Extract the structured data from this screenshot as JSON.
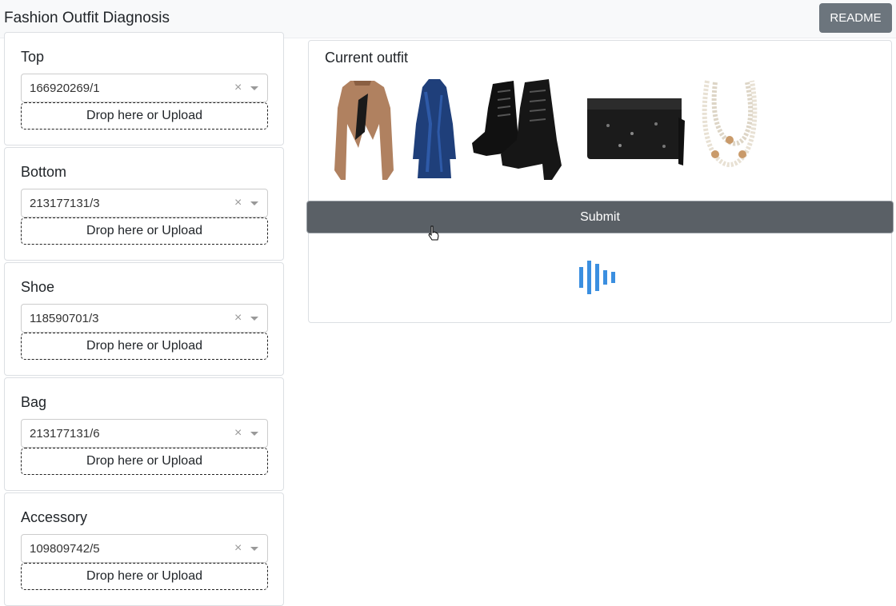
{
  "app": {
    "title": "Fashion Outfit Diagnosis",
    "readme_label": "README"
  },
  "categories": [
    {
      "title": "Top",
      "value": "166920269/1",
      "upload_label": "Drop here or Upload"
    },
    {
      "title": "Bottom",
      "value": "213177131/3",
      "upload_label": "Drop here or Upload"
    },
    {
      "title": "Shoe",
      "value": "118590701/3",
      "upload_label": "Drop here or Upload"
    },
    {
      "title": "Bag",
      "value": "213177131/6",
      "upload_label": "Drop here or Upload"
    },
    {
      "title": "Accessory",
      "value": "109809742/5",
      "upload_label": "Drop here or Upload"
    }
  ],
  "outfit": {
    "title": "Current outfit",
    "items": [
      "cropped-jacket-image",
      "velvet-dress-image",
      "platform-boots-image",
      "sequin-clutch-image",
      "pearl-necklace-image"
    ]
  },
  "submit_label": "Submit",
  "select_clear_glyph": "×",
  "colors": {
    "navbar_bg": "#f8f9fa",
    "button_gray": "#6c757d",
    "submit_bg": "#5a6066",
    "spinner_blue": "#3b8fe0"
  }
}
